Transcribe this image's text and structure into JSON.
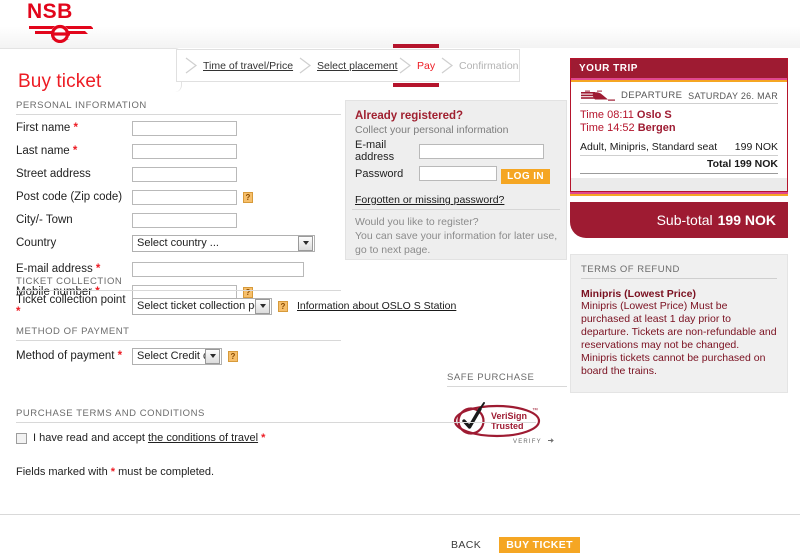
{
  "brand": {
    "name": "NSB",
    "logo_color": "#e2051b"
  },
  "page": {
    "title": "Buy ticket"
  },
  "steps": [
    {
      "label": "Time of travel/Price",
      "state": "done"
    },
    {
      "label": "Select placement",
      "state": "done"
    },
    {
      "label": "Pay",
      "state": "current"
    },
    {
      "label": "Confirmation",
      "state": "future"
    }
  ],
  "personal": {
    "section_title": "PERSONAL INFORMATION",
    "fields": [
      {
        "label": "First name",
        "required": true,
        "value": "",
        "help": false
      },
      {
        "label": "Last name",
        "required": true,
        "value": "",
        "help": false
      },
      {
        "label": "Street address",
        "required": false,
        "value": "",
        "help": false
      },
      {
        "label": "Post code (Zip code)",
        "required": false,
        "value": "",
        "help": true
      },
      {
        "label": "City/- Town",
        "required": false,
        "value": "",
        "help": false
      },
      {
        "label": "Country",
        "required": false,
        "value": "Select country ...",
        "help": false
      },
      {
        "label": "E-mail address",
        "required": true,
        "value": "",
        "help": false
      },
      {
        "label": "Mobile number",
        "required": true,
        "value": "",
        "help": true
      }
    ],
    "country_selected": "Select country ..."
  },
  "registered": {
    "heading": "Already registered?",
    "subtitle": "Collect your personal information",
    "email_label": "E-mail address",
    "email_value": "",
    "password_label": "Password",
    "password_value": "",
    "login_label": "LOG IN",
    "forgot_link": "Forgotten or missing password?",
    "register_heading": "Would you like to register?",
    "register_text": "You can save your information for later use, go to next page."
  },
  "ticket_collection": {
    "section_title": "TICKET COLLECTION",
    "label": "Ticket collection point",
    "selected": "Select ticket collection point ...",
    "info_link": "Information about OSLO S Station"
  },
  "payment": {
    "section_title": "METHOD OF PAYMENT",
    "label": "Method of payment",
    "selected": "Select Credit card"
  },
  "safe_purchase": {
    "section_title": "SAFE PURCHASE",
    "badge_line1": "VeriSign",
    "badge_line2": "Trusted",
    "badge_tm": "™",
    "badge_verify": "VERIFY"
  },
  "terms": {
    "section_title": "PURCHASE TERMS AND CONDITIONS",
    "accept_prefix": "I have read and accept ",
    "accept_link": "the conditions of travel",
    "accept_required": "*",
    "checked": false,
    "fields_note_prefix": "Fields marked with ",
    "fields_note_star": "*",
    "fields_note_suffix": " must be completed."
  },
  "footer": {
    "back_label": "BACK",
    "buy_label": "BUY TICKET"
  },
  "trip": {
    "panel_title": "YOUR TRIP",
    "departure_label": "DEPARTURE",
    "date": "SATURDAY 26. MAR",
    "legs": [
      {
        "time_label": "Time",
        "time": "08:11",
        "station": "Oslo S"
      },
      {
        "time_label": "Time",
        "time": "14:52",
        "station": "Bergen"
      }
    ],
    "price_desc": "Adult, Minipris, Standard seat",
    "price_amount": "199 NOK",
    "total_label": "Total",
    "total_amount": "199 NOK",
    "subtotal_label": "Sub-total",
    "subtotal_amount": "199 NOK"
  },
  "refund": {
    "section_title": "TERMS OF REFUND",
    "title": "Minipris (Lowest Price)",
    "text": "Minipris (Lowest Price) Must be purchased at least 1 day prior to departure. Tickets are non-refundable and reservations may not be changed. Minipris tickets cannot be purchased on board the trains."
  },
  "colors": {
    "brand_red": "#e2051b",
    "title_red": "#ed1c24",
    "dark_red": "#9e1b32",
    "orange": "#f5a623",
    "panel_grey": "#eeeeee"
  }
}
